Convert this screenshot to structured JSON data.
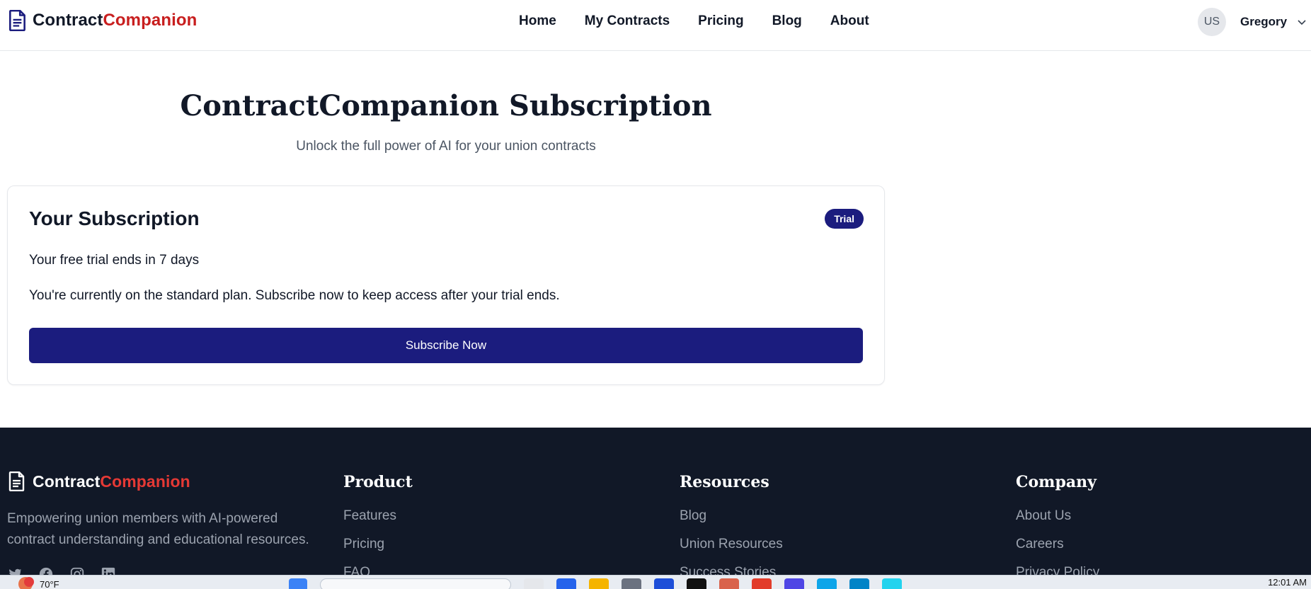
{
  "header": {
    "brand_part1": "Contract",
    "brand_part2": "Companion",
    "nav": [
      "Home",
      "My Contracts",
      "Pricing",
      "Blog",
      "About"
    ],
    "avatar_initials": "US",
    "user_name": "Gregory"
  },
  "main": {
    "title": "ContractCompanion Subscription",
    "subtitle": "Unlock the full power of AI for your union contracts"
  },
  "subscription": {
    "title": "Your Subscription",
    "badge": "Trial",
    "trial_text": "Your free trial ends in 7 days",
    "plan_text": "You're currently on the standard plan. Subscribe now to keep access after your trial ends.",
    "button_label": "Subscribe Now"
  },
  "footer": {
    "brand_part1": "Contract",
    "brand_part2": "Companion",
    "description": "Empowering union members with AI-powered contract understanding and educational resources.",
    "product": {
      "heading": "Product",
      "links": [
        "Features",
        "Pricing",
        "FAQ"
      ]
    },
    "resources": {
      "heading": "Resources",
      "links": [
        "Blog",
        "Union Resources",
        "Success Stories"
      ]
    },
    "company": {
      "heading": "Company",
      "links": [
        "About Us",
        "Careers",
        "Privacy Policy"
      ]
    }
  },
  "taskbar": {
    "weather_temp": "70°F",
    "clock": "12:01 AM"
  },
  "colors": {
    "primary": "#1b1c7e",
    "brand_red": "#c81e1e",
    "footer_bg": "#111827"
  }
}
